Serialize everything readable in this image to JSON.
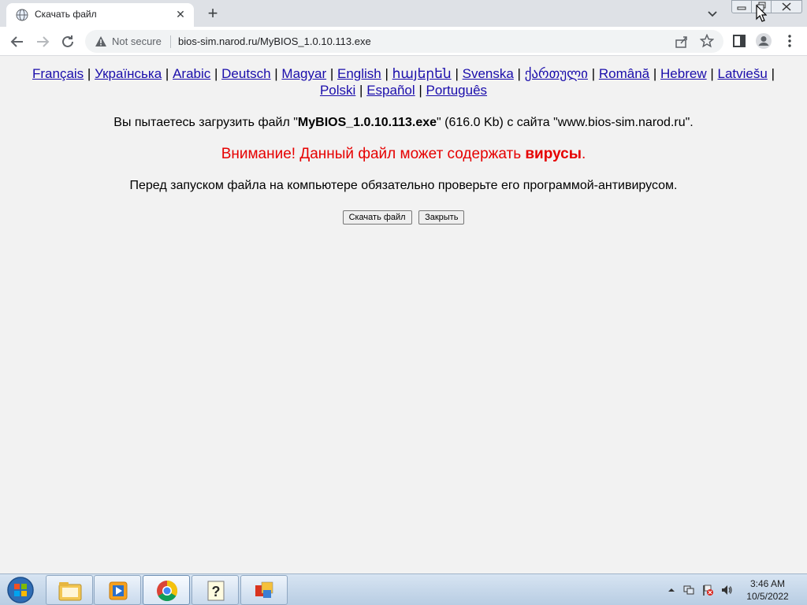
{
  "tab": {
    "title": "Скачать файл",
    "close": "✕",
    "new_tab": "+"
  },
  "toolbar": {
    "security_label": "Not secure",
    "url": "bios-sim.narod.ru/MyBIOS_1.0.10.113.exe"
  },
  "languages": [
    "Français",
    "Українська",
    "Arabic",
    "Deutsch",
    "Magyar",
    "English",
    "հայերեն",
    "Svenska",
    "ქართული",
    "Română",
    "Hebrew",
    "Latviešu",
    "Polski",
    "Español",
    "Português"
  ],
  "language_separator": "|",
  "message": {
    "line1_prefix": "Вы пытаетесь загрузить файл \"",
    "line1_filename": "MyBIOS_1.0.10.113.exe",
    "line1_suffix": "\" (616.0 Kb) с сайта \"www.bios-sim.narod.ru\".",
    "warning_prefix": "Внимание! Данный файл может содержать ",
    "warning_bold": "вирусы",
    "warning_suffix": ".",
    "advice": "Перед запуском файла на компьютере обязательно проверьте его программой-антивирусом."
  },
  "buttons": {
    "download": "Скачать файл",
    "close": "Закрыть"
  },
  "taskbar": {
    "time": "3:46 AM",
    "date": "10/5/2022"
  },
  "colors": {
    "warning": "#e60000",
    "link": "#1a0dab",
    "tab_strip": "#dee1e6"
  }
}
